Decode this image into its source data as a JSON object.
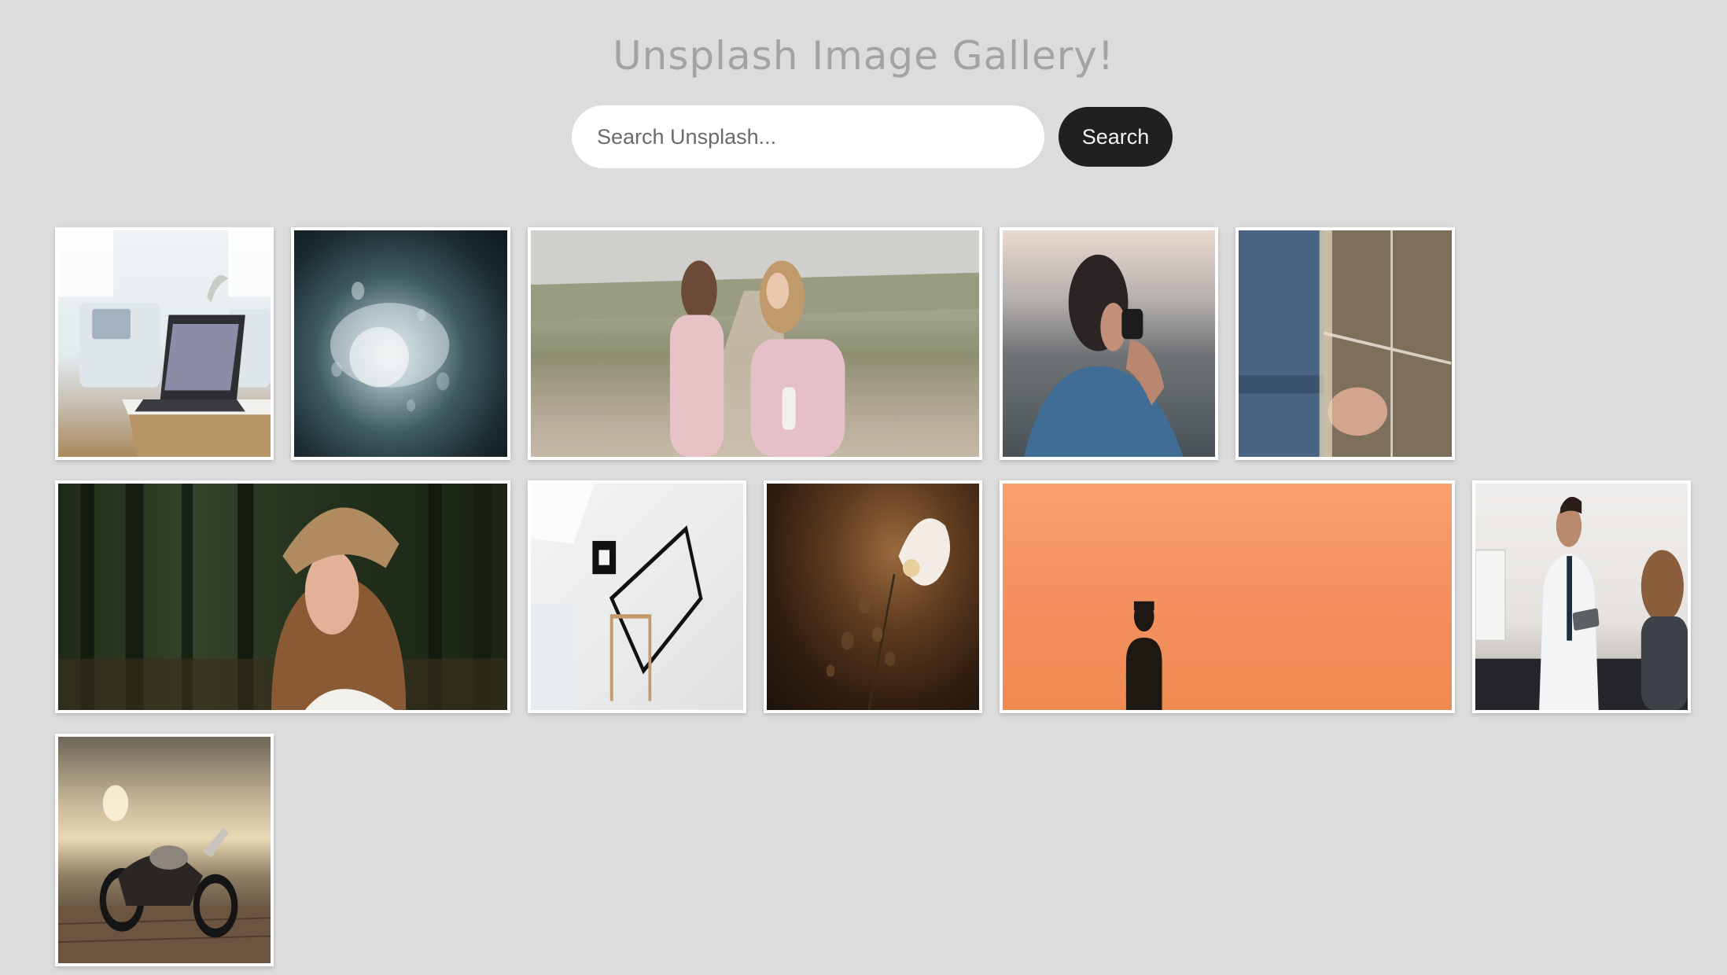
{
  "header": {
    "title": "Unsplash Image Gallery!"
  },
  "search": {
    "placeholder": "Search Unsplash...",
    "value": "",
    "button_label": "Search"
  },
  "colors": {
    "background": "#dcdcdc",
    "title": "#a3a3a3",
    "button_bg": "#202020",
    "tile_border": "#ffffff"
  },
  "gallery": {
    "images": [
      {
        "subject": "laptop-on-table"
      },
      {
        "subject": "water-splash"
      },
      {
        "subject": "mother-and-daughter"
      },
      {
        "subject": "man-with-camera"
      },
      {
        "subject": "holding-hands"
      },
      {
        "subject": "woman-in-forest"
      },
      {
        "subject": "minimal-frame"
      },
      {
        "subject": "white-flower"
      },
      {
        "subject": "silhouette-orange-sky"
      },
      {
        "subject": "doctor-with-tablet"
      },
      {
        "subject": "motorcycle-sunset"
      }
    ]
  }
}
